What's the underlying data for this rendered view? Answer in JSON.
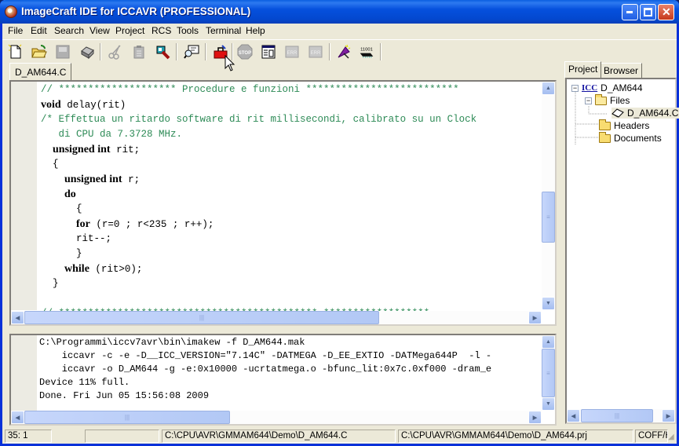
{
  "window": {
    "title": "ImageCraft IDE for ICCAVR (PROFESSIONAL)",
    "controls": {
      "minimize": "_",
      "maximize": "□",
      "close": "✕"
    }
  },
  "menu": [
    "File",
    "Edit",
    "Search",
    "View",
    "Project",
    "RCS",
    "Tools",
    "Terminal",
    "Help"
  ],
  "toolbar": {
    "buttons": [
      {
        "name": "new-file-icon",
        "enabled": true
      },
      {
        "name": "open-folder-icon",
        "enabled": true
      },
      {
        "name": "save-icon",
        "enabled": false
      },
      {
        "name": "print-icon",
        "enabled": true
      },
      {
        "name": "cut-icon",
        "enabled": false
      },
      {
        "name": "paste-icon",
        "enabled": false
      },
      {
        "name": "find-icon",
        "enabled": true
      },
      {
        "name": "find-in-files-icon",
        "enabled": true
      },
      {
        "name": "build-icon",
        "enabled": true
      },
      {
        "name": "stop-icon",
        "enabled": false
      },
      {
        "name": "application-builder-icon",
        "enabled": true
      },
      {
        "name": "previous-error-icon",
        "enabled": false
      },
      {
        "name": "next-error-icon",
        "enabled": false
      },
      {
        "name": "program-chip-icon",
        "enabled": true
      },
      {
        "name": "bits-chip-icon",
        "enabled": true
      }
    ],
    "bits_label": "11001",
    "stop_label": "STOP",
    "err_label": "ERR"
  },
  "editor": {
    "tab_label": "D_AM644.C",
    "lines": [
      [
        {
          "t": "// ******************** Procedure e funzioni **************************",
          "c": "cm"
        }
      ],
      [
        {
          "t": "void",
          "c": "kw"
        },
        {
          "t": " delay(rit)",
          "c": ""
        }
      ],
      [
        {
          "t": "/* Effettua un ritardo software di rit millisecondi, calibrato su un Clock",
          "c": "cm"
        }
      ],
      [
        {
          "t": "   di CPU da 7.3728 MHz.",
          "c": "cm"
        }
      ],
      [
        {
          "t": "  ",
          "c": ""
        },
        {
          "t": "unsigned int",
          "c": "kw"
        },
        {
          "t": " rit;",
          "c": ""
        }
      ],
      [
        {
          "t": "  {",
          "c": ""
        }
      ],
      [
        {
          "t": "    ",
          "c": ""
        },
        {
          "t": "unsigned int",
          "c": "kw"
        },
        {
          "t": " r;",
          "c": ""
        }
      ],
      [
        {
          "t": "    ",
          "c": ""
        },
        {
          "t": "do",
          "c": "kw"
        }
      ],
      [
        {
          "t": "      {",
          "c": ""
        }
      ],
      [
        {
          "t": "      ",
          "c": ""
        },
        {
          "t": "for",
          "c": "kw"
        },
        {
          "t": " (r=0 ; r<235 ; r++);",
          "c": ""
        }
      ],
      [
        {
          "t": "      rit--;",
          "c": ""
        }
      ],
      [
        {
          "t": "      }",
          "c": ""
        }
      ],
      [
        {
          "t": "    ",
          "c": ""
        },
        {
          "t": "while",
          "c": "kw"
        },
        {
          "t": " (rit>0);",
          "c": ""
        }
      ],
      [
        {
          "t": "  }",
          "c": ""
        }
      ],
      [
        {
          "t": "",
          "c": ""
        }
      ],
      [
        {
          "t": "// ******************************************** ******************",
          "c": "cm"
        }
      ]
    ]
  },
  "output": {
    "lines": [
      "C:\\Programmi\\iccv7avr\\bin\\imakew -f D_AM644.mak",
      "    iccavr -c -e -D__ICC_VERSION=\"7.14C\" -DATMEGA -D_EE_EXTIO -DATMega644P  -l -",
      "    iccavr -o D_AM644 -g -e:0x10000 -ucrtatmega.o -bfunc_lit:0x7c.0xf000 -dram_e",
      "Device 11% full.",
      "Done. Fri Jun 05 15:56:08 2009"
    ]
  },
  "project_panel": {
    "tabs": [
      "Project",
      "Browser"
    ],
    "active_tab": "Project",
    "tree": {
      "root": "D_AM644",
      "root_icon_label": "ICC",
      "files_folder": "Files",
      "file": "D_AM644.C",
      "headers_folder": "Headers",
      "documents_folder": "Documents"
    }
  },
  "statusbar": {
    "position": "35: 1",
    "empty": "",
    "file_path": "C:\\CPU\\AVR\\GMMAM644\\Demo\\D_AM644.C",
    "project_path": "C:\\CPU\\AVR\\GMMAM644\\Demo\\D_AM644.prj",
    "format": "COFF/H"
  },
  "scroll": {
    "grip": "|||",
    "up": "▲",
    "down": "▼",
    "left": "◀",
    "right": "▶"
  }
}
